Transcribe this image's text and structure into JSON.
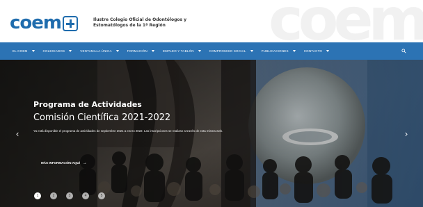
{
  "header": {
    "logo_text": "coem",
    "title": "Ilustre Colegio Oficial de Odontólogos y\nEstomatólogos de la 1ª Región",
    "watermark": "coem"
  },
  "nav": {
    "items": [
      "EL COEM",
      "COLEGIADOS",
      "VENTANILLA ÚNICA",
      "FORMACIÓN",
      "EMPLEO Y TABLÓN",
      "COMPROMISO SOCIAL",
      "PUBLICACIONES",
      "CONTACTO"
    ],
    "icons": {
      "caret": "chevron-down-icon",
      "search": "search-icon"
    }
  },
  "hero": {
    "kicker": "Programa de Actividades",
    "title": "Comisión Científica 2021-2022",
    "description": "Ya está disponible el programa de actividades de septiembre 2021 a enero 2022. Las inscripciones se realizan a través de esta misma web.",
    "cta": "MÁS INFORMACIÓN AQUÍ",
    "arrow_left": "‹",
    "arrow_right": "›",
    "dots": [
      "1",
      "2",
      "3",
      "4",
      "5"
    ]
  },
  "colors": {
    "brand": "#2c73b4",
    "logo": "#1f6cad",
    "hero_dark": "#3d3a36"
  }
}
